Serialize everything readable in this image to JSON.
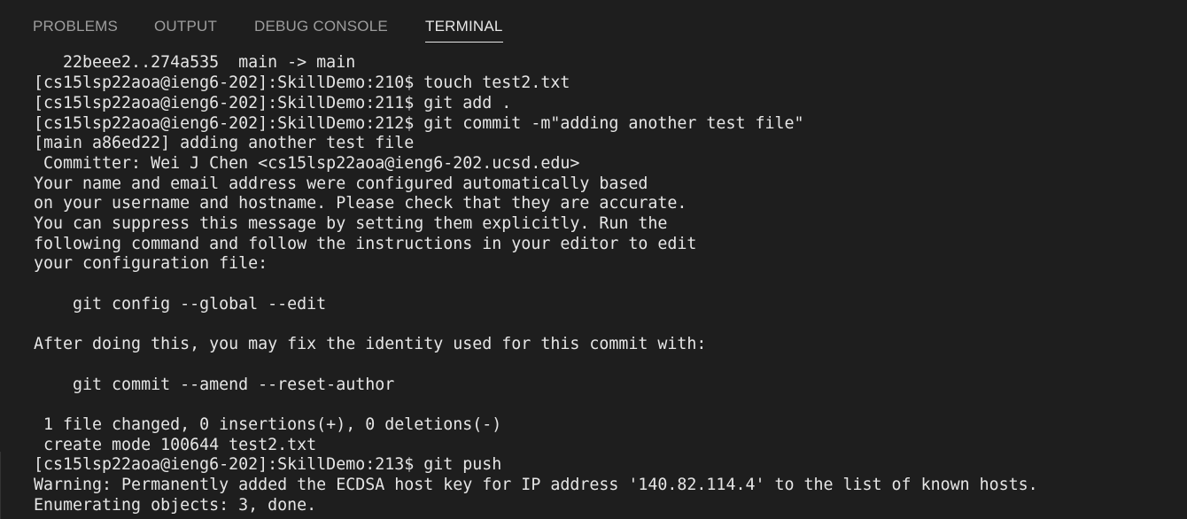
{
  "panel": {
    "tabs": [
      {
        "label": "PROBLEMS"
      },
      {
        "label": "OUTPUT"
      },
      {
        "label": "DEBUG CONSOLE"
      },
      {
        "label": "TERMINAL"
      }
    ],
    "active_tab": "TERMINAL"
  },
  "terminal": {
    "lines": [
      "   22beee2..274a535  main -> main",
      "[cs15lsp22aoa@ieng6-202]:SkillDemo:210$ touch test2.txt",
      "[cs15lsp22aoa@ieng6-202]:SkillDemo:211$ git add .",
      "[cs15lsp22aoa@ieng6-202]:SkillDemo:212$ git commit -m\"adding another test file\"",
      "[main a86ed22] adding another test file",
      " Committer: Wei J Chen <cs15lsp22aoa@ieng6-202.ucsd.edu>",
      "Your name and email address were configured automatically based",
      "on your username and hostname. Please check that they are accurate.",
      "You can suppress this message by setting them explicitly. Run the",
      "following command and follow the instructions in your editor to edit",
      "your configuration file:",
      "",
      "    git config --global --edit",
      "",
      "After doing this, you may fix the identity used for this commit with:",
      "",
      "    git commit --amend --reset-author",
      "",
      " 1 file changed, 0 insertions(+), 0 deletions(-)",
      " create mode 100644 test2.txt",
      "[cs15lsp22aoa@ieng6-202]:SkillDemo:213$ git push",
      "Warning: Permanently added the ECDSA host key for IP address '140.82.114.4' to the list of known hosts.",
      "Enumerating objects: 3, done."
    ]
  }
}
